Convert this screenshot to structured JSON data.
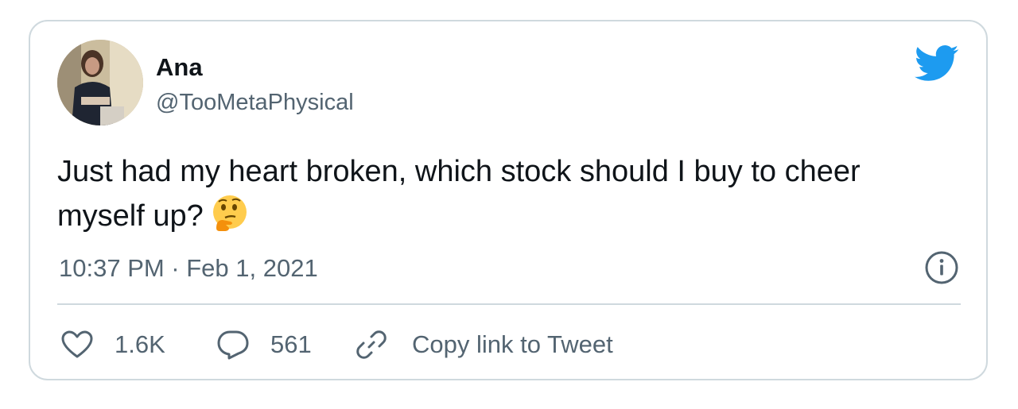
{
  "tweet": {
    "author": {
      "name": "Ana",
      "handle": "@TooMetaPhysical"
    },
    "text": "Just had my heart broken, which stock should I buy to cheer myself up?",
    "emoji": "thinking-face-emoji",
    "timestamp": "10:37 PM · Feb 1, 2021",
    "actions": {
      "likes": "1.6K",
      "replies": "561",
      "copy_link_label": "Copy link to Tweet"
    },
    "icons": {
      "brand": "twitter-bird-icon",
      "info": "info-icon",
      "like": "heart-icon",
      "reply": "reply-icon",
      "copy": "link-icon"
    },
    "colors": {
      "brand": "#1d9bf0",
      "text": "#0f1419",
      "secondary": "#536471",
      "border": "#cfd9de"
    }
  }
}
